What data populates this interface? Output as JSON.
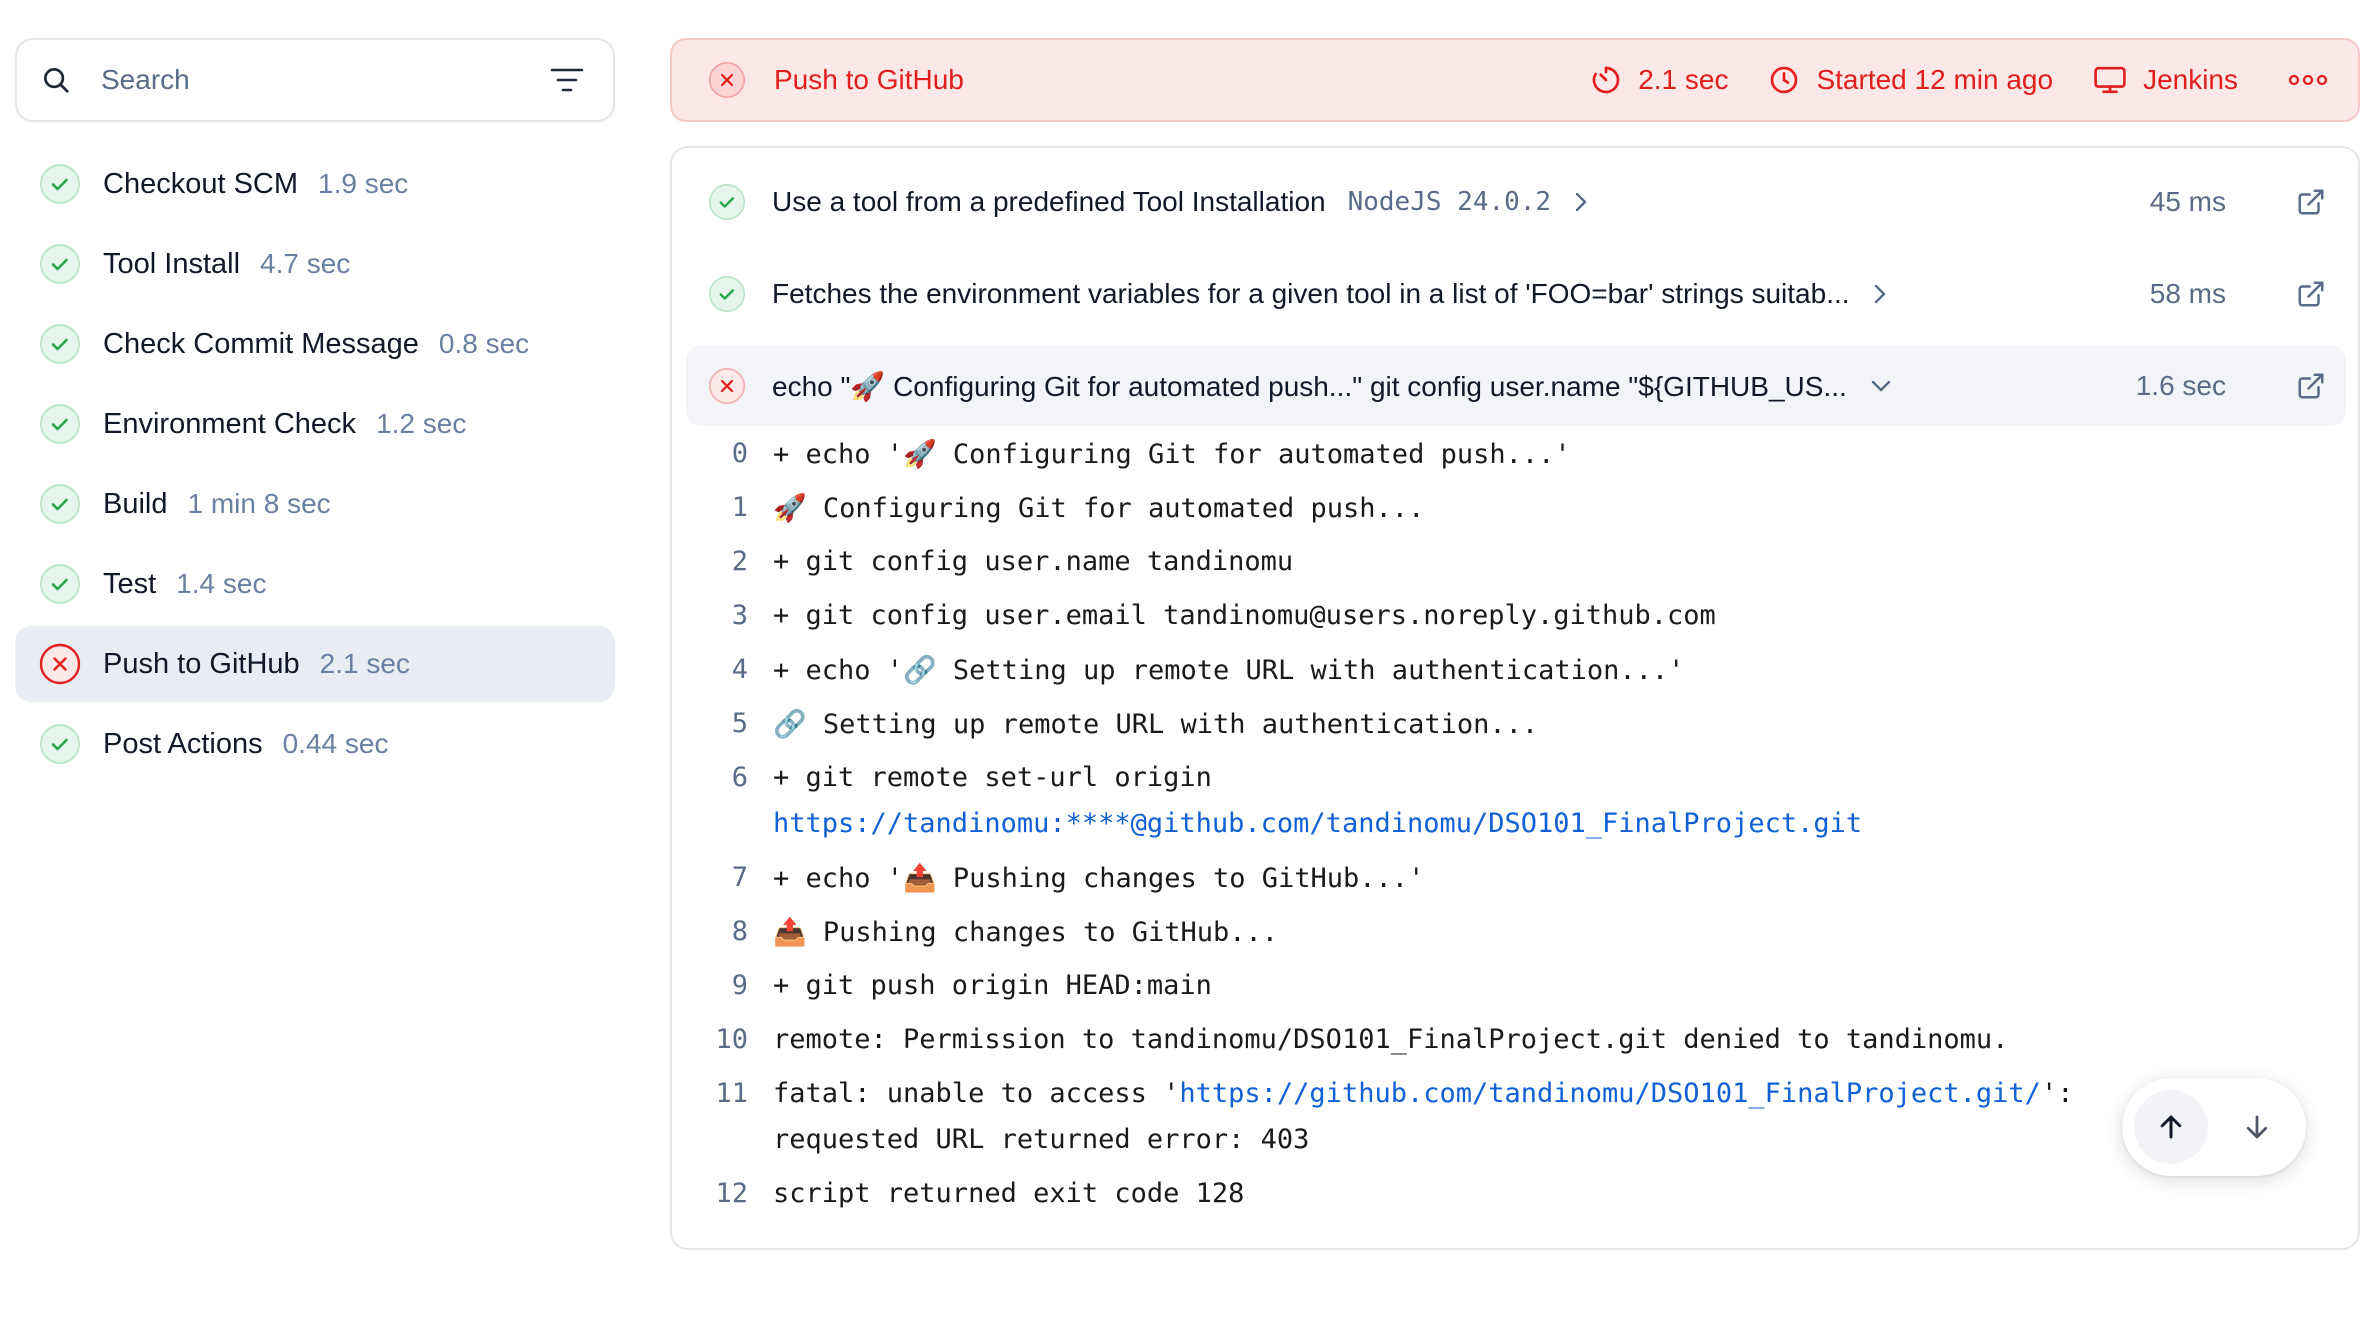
{
  "sidebar": {
    "search": {
      "placeholder": "Search"
    },
    "stages": [
      {
        "name": "Checkout SCM",
        "duration": "1.9 sec",
        "status": "success"
      },
      {
        "name": "Tool Install",
        "duration": "4.7 sec",
        "status": "success"
      },
      {
        "name": "Check Commit Message",
        "duration": "0.8 sec",
        "status": "success"
      },
      {
        "name": "Environment Check",
        "duration": "1.2 sec",
        "status": "success"
      },
      {
        "name": "Build",
        "duration": "1 min 8 sec",
        "status": "success"
      },
      {
        "name": "Test",
        "duration": "1.4 sec",
        "status": "success"
      },
      {
        "name": "Push to GitHub",
        "duration": "2.1 sec",
        "status": "failed"
      },
      {
        "name": "Post Actions",
        "duration": "0.44 sec",
        "status": "success"
      }
    ]
  },
  "header": {
    "title": "Push to GitHub",
    "duration": "2.1 sec",
    "started": "Started 12 min ago",
    "agent": "Jenkins"
  },
  "steps": [
    {
      "label": "Use a tool from a predefined Tool Installation",
      "tool": "NodeJS 24.0.2",
      "time": "45 ms",
      "status": "success"
    },
    {
      "label": "Fetches the environment variables for a given tool in a list of 'FOO=bar' strings suitab...",
      "time": "58 ms",
      "status": "success"
    },
    {
      "label": "echo \"🚀 Configuring Git for automated push...\" git config user.name \"${GITHUB_US...",
      "time": "1.6 sec",
      "status": "failed"
    }
  ],
  "log": [
    {
      "n": "0",
      "text": "+ echo '🚀 Configuring Git for automated push...'"
    },
    {
      "n": "1",
      "text": "🚀 Configuring Git for automated push..."
    },
    {
      "n": "2",
      "text": "+ git config user.name tandinomu"
    },
    {
      "n": "3",
      "text": "+ git config user.email tandinomu@users.noreply.github.com"
    },
    {
      "n": "4",
      "text": "+ echo '🔗 Setting up remote URL with authentication...'"
    },
    {
      "n": "5",
      "text": "🔗 Setting up remote URL with authentication..."
    },
    {
      "n": "6",
      "text": "+ git remote set-url origin",
      "link": "https://tandinomu:****@github.com/tandinomu/DSO101_FinalProject.git"
    },
    {
      "n": "7",
      "text": "+ echo '📤 Pushing changes to GitHub...'"
    },
    {
      "n": "8",
      "text": "📤 Pushing changes to GitHub..."
    },
    {
      "n": "9",
      "text": "+ git push origin HEAD:main"
    },
    {
      "n": "10",
      "text": "remote: Permission to tandinomu/DSO101_FinalProject.git denied to tandinomu."
    },
    {
      "n": "11",
      "pre": "fatal: unable to access '",
      "link": "https://github.com/tandinomu/DSO101_FinalProject.git/",
      "post": "':",
      "cont": "requested URL returned error: 403"
    },
    {
      "n": "12",
      "text": "script returned exit code 128"
    }
  ],
  "colors": {
    "success": "#22a74a",
    "failed": "#e11d1d",
    "link": "#1060d6",
    "muted": "#6b7fa3"
  },
  "icons": {
    "search": "search-icon",
    "filter": "filter-icon",
    "success": "check-circle-icon",
    "failed": "x-circle-icon",
    "timer": "timer-icon",
    "clock": "clock-icon",
    "agent": "monitor-icon",
    "more": "more-icon",
    "expand": "chevron-right-icon",
    "collapse": "chevron-down-icon",
    "external": "external-link-icon",
    "up": "arrow-up-icon",
    "down": "arrow-down-icon"
  }
}
